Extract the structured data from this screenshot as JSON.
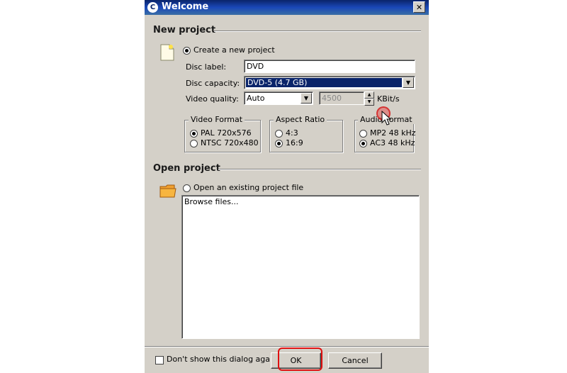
{
  "window": {
    "title": "Welcome",
    "close_glyph": "✕",
    "app_icon_glyph": "C"
  },
  "new_project": {
    "heading": "New project",
    "create_option": "Create a new project",
    "disc_label": {
      "label": "Disc label:",
      "value": "DVD"
    },
    "disc_capacity": {
      "label": "Disc capacity:",
      "value": "DVD-5 (4.7 GB)"
    },
    "video_quality": {
      "label": "Video quality:",
      "value": "Auto",
      "bitrate": "4500",
      "unit": "KBit/s"
    },
    "video_format": {
      "title": "Video Format",
      "options": [
        "PAL 720x576",
        "NTSC 720x480"
      ],
      "selected": 0
    },
    "aspect_ratio": {
      "title": "Aspect Ratio",
      "options": [
        "4:3",
        "16:9"
      ],
      "selected": 1
    },
    "audio_format": {
      "title": "Audio Format",
      "options": [
        "MP2 48 kHz",
        "AC3 48 kHz"
      ],
      "selected": 1
    }
  },
  "open_project": {
    "heading": "Open project",
    "open_option": "Open an existing project file",
    "browse_text": "Browse files..."
  },
  "footer": {
    "dont_show": "Don't show this dialog again",
    "ok": "OK",
    "cancel": "Cancel"
  },
  "colors": {
    "titlebar": "#0a246a",
    "selection": "#0a246a",
    "highlight_ring": "#e02020"
  }
}
